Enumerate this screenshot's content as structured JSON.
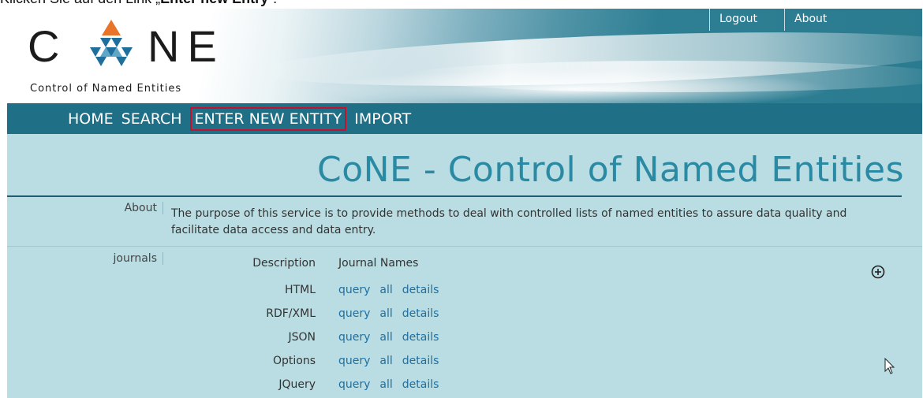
{
  "caption": {
    "prefix": "Klicken Sie auf den Link „",
    "link": "Enter new Entry",
    "suffix": "“."
  },
  "header": {
    "logo_c": "C",
    "logo_ne": "NE",
    "logo_tagline": "Control of Named Entities",
    "top_links": [
      "Logout",
      "About"
    ]
  },
  "nav": {
    "items": [
      "HOME",
      "SEARCH",
      "ENTER NEW ENTITY",
      "IMPORT"
    ],
    "highlighted": "ENTER NEW ENTITY"
  },
  "main": {
    "title": "CoNE - Control of Named Entities",
    "about_label": "About",
    "about_text": "The purpose of this service is to provide methods to deal with controlled lists of named entities to assure data quality and facilitate data access and data entry.",
    "journals_label": "journals",
    "columns": {
      "description": "Description",
      "names": "Journal Names"
    },
    "formats": [
      {
        "name": "HTML",
        "links": [
          "query",
          "all",
          "details"
        ]
      },
      {
        "name": "RDF/XML",
        "links": [
          "query",
          "all",
          "details"
        ]
      },
      {
        "name": "JSON",
        "links": [
          "query",
          "all",
          "details"
        ]
      },
      {
        "name": "Options",
        "links": [
          "query",
          "all",
          "details"
        ]
      },
      {
        "name": "JQuery",
        "links": [
          "query",
          "all",
          "details"
        ]
      }
    ],
    "expand_icon": "circle-plus-icon"
  },
  "colors": {
    "nav_bg": "#1f6f86",
    "content_bg": "#b9dde2",
    "title": "#2a8aa3",
    "link": "#1f6fa0",
    "highlight_border": "#c8102e",
    "logo_orange": "#e8742a",
    "logo_blue": "#1f6f9c"
  }
}
